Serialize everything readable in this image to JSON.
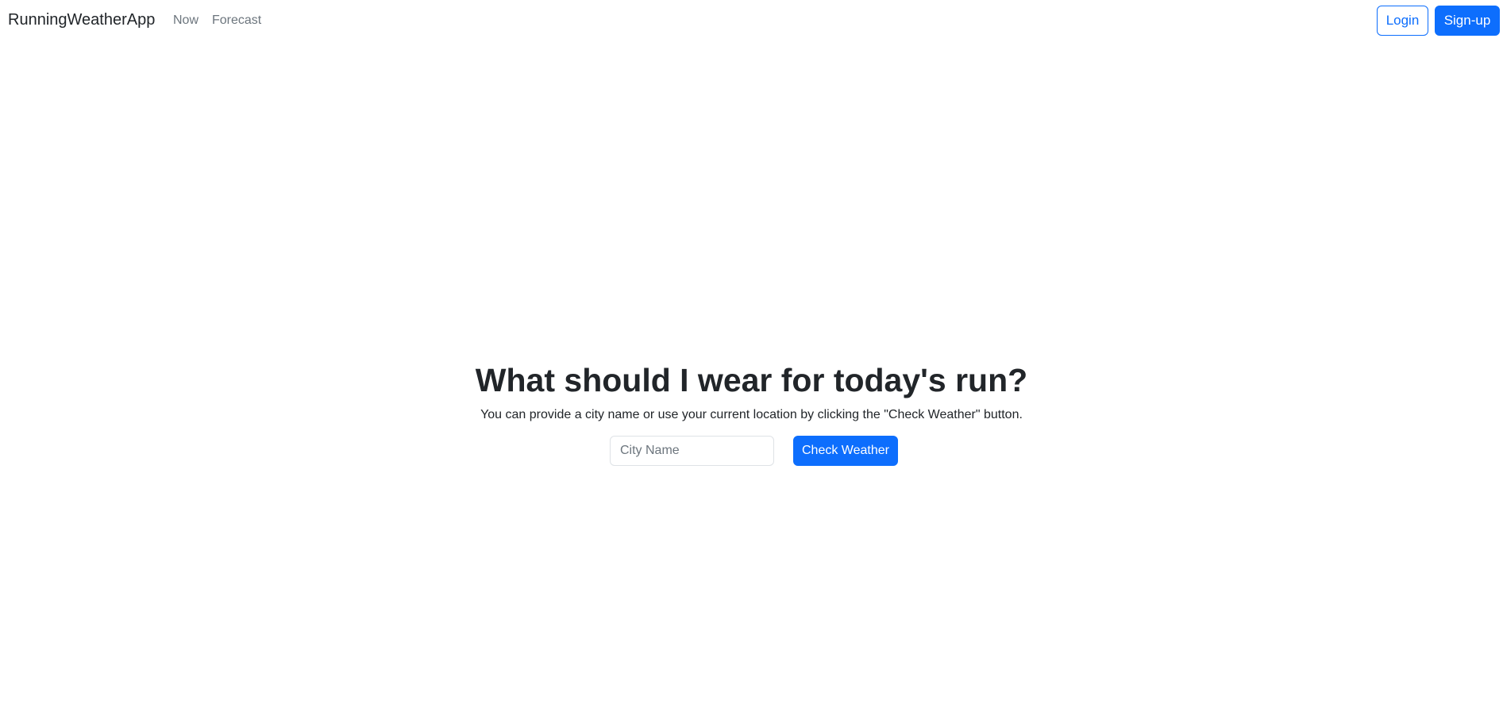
{
  "navbar": {
    "brand": "RunningWeatherApp",
    "links": [
      "Now",
      "Forecast"
    ],
    "login_label": "Login",
    "signup_label": "Sign-up"
  },
  "hero": {
    "title": "What should I wear for today's run?",
    "subtitle": "You can provide a city name or use your current location by clicking the \"Check Weather\" button."
  },
  "search": {
    "city_placeholder": "City Name",
    "city_value": "",
    "check_label": "Check Weather"
  },
  "colors": {
    "primary": "#0d6efd",
    "text": "#212529",
    "muted": "#6c757d",
    "border": "#dee2e6"
  }
}
